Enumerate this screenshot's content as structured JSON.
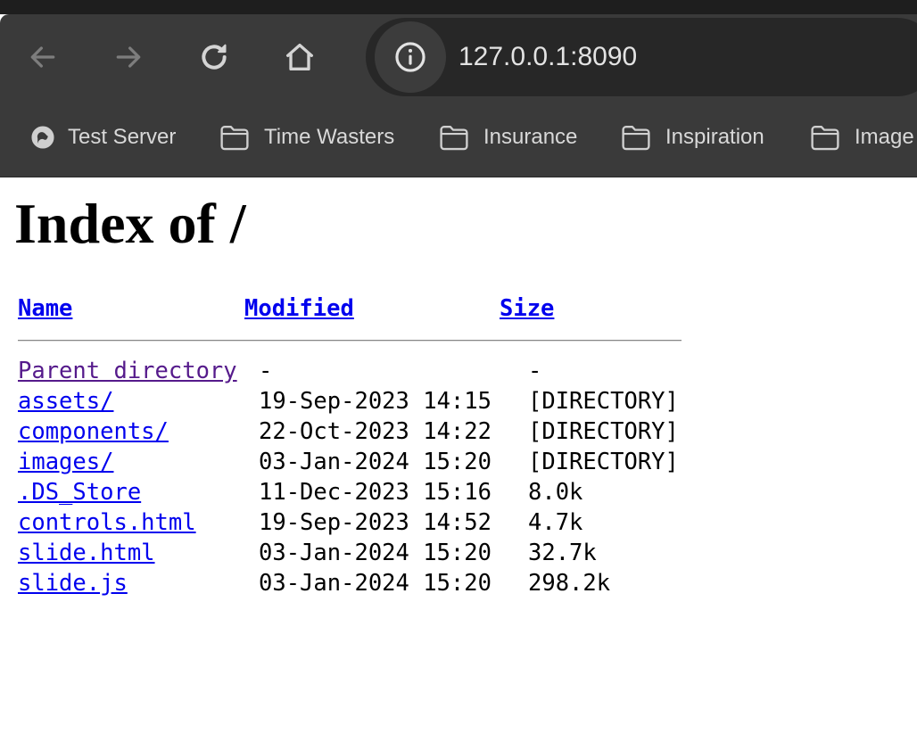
{
  "browser": {
    "url": "127.0.0.1:8090",
    "bookmarks": [
      {
        "label": "Test Server",
        "icon": "globe-icon"
      },
      {
        "label": "Time Wasters",
        "icon": "folder-icon"
      },
      {
        "label": "Insurance",
        "icon": "folder-icon"
      },
      {
        "label": "Inspiration",
        "icon": "folder-icon"
      },
      {
        "label": "Image",
        "icon": "folder-icon"
      }
    ]
  },
  "page": {
    "title": "Index of /",
    "columns": {
      "name": "Name",
      "modified": "Modified",
      "size": "Size"
    },
    "entries": [
      {
        "name": "Parent directory",
        "modified": "-",
        "size": "-"
      },
      {
        "name": "assets/",
        "modified": "19-Sep-2023 14:15",
        "size": "[DIRECTORY]"
      },
      {
        "name": "components/",
        "modified": "22-Oct-2023 14:22",
        "size": "[DIRECTORY]"
      },
      {
        "name": "images/",
        "modified": "03-Jan-2024 15:20",
        "size": "[DIRECTORY]"
      },
      {
        "name": ".DS_Store",
        "modified": "11-Dec-2023 15:16",
        "size": "8.0k"
      },
      {
        "name": "controls.html",
        "modified": "19-Sep-2023 14:52",
        "size": "4.7k"
      },
      {
        "name": "slide.html",
        "modified": "03-Jan-2024 15:20",
        "size": "32.7k"
      },
      {
        "name": "slide.js",
        "modified": "03-Jan-2024 15:20",
        "size": "298.2k"
      }
    ]
  },
  "colors": {
    "link": "#0000ee",
    "visited_link": "#551a8b",
    "toolbar_bg": "#3a3a3a",
    "omnibox_bg": "#272727"
  }
}
